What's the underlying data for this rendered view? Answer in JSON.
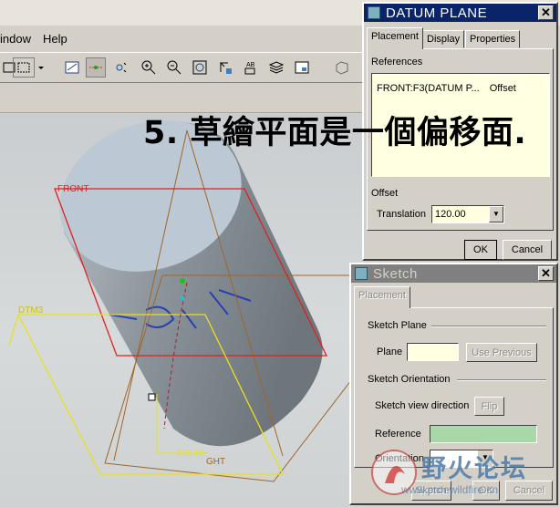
{
  "menubar": {
    "items": [
      "indow",
      "Help"
    ]
  },
  "viewport": {
    "labels": {
      "front": "FRONT",
      "dtm3": "DTM3",
      "dim": "120.00",
      "right": "GHT"
    }
  },
  "caption": "5. 草繪平面是一個偏移面.",
  "datum_dialog": {
    "title": "DATUM PLANE",
    "tabs": [
      "Placement",
      "Display",
      "Properties"
    ],
    "references_label": "References",
    "reference_entry": {
      "name": "FRONT:F3(DATUM P...",
      "type": "Offset"
    },
    "offset_label": "Offset",
    "translation_label": "Translation",
    "translation_value": "120.00",
    "ok": "OK",
    "cancel": "Cancel"
  },
  "sketch_dialog": {
    "title": "Sketch",
    "tab": "Placement",
    "sketch_plane_label": "Sketch Plane",
    "plane_label": "Plane",
    "use_previous": "Use Previous",
    "sketch_orientation_label": "Sketch Orientation",
    "view_direction_label": "Sketch view direction",
    "flip": "Flip",
    "reference_label": "Reference",
    "orientation_label": "Orientation",
    "sketch": "Sketch",
    "ok": "OK",
    "cancel": "Cancel"
  },
  "watermark": {
    "main": "野火论坛",
    "sub": "www.proewildfire.cn"
  },
  "colors": {
    "title_active": "#0a246a",
    "title_inactive": "#808080",
    "front_plane": "#e02020",
    "dtm_plane": "#e8e020"
  }
}
